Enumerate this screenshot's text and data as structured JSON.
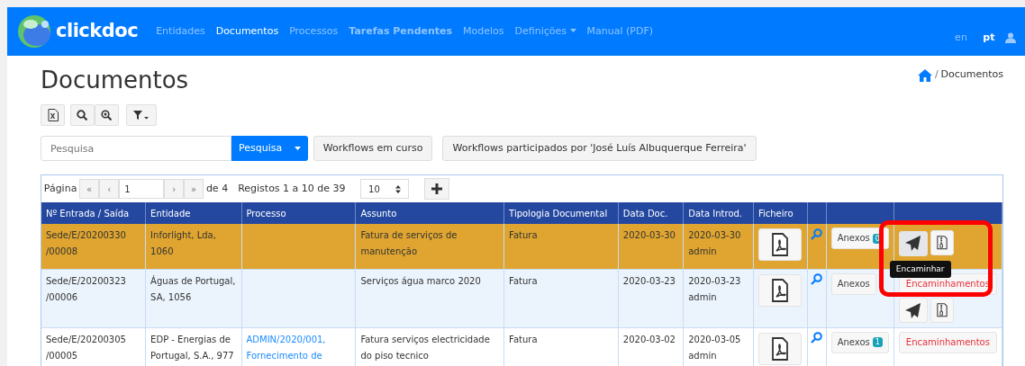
{
  "brand": {
    "name": "clickdoc"
  },
  "nav": [
    {
      "label": "Entidades",
      "selected": false,
      "bold": false,
      "dropdown": false
    },
    {
      "label": "Documentos",
      "selected": true,
      "bold": false,
      "dropdown": false
    },
    {
      "label": "Processos",
      "selected": false,
      "bold": false,
      "dropdown": false
    },
    {
      "label": "Tarefas Pendentes",
      "selected": false,
      "bold": true,
      "dropdown": false
    },
    {
      "label": "Modelos",
      "selected": false,
      "bold": false,
      "dropdown": false
    },
    {
      "label": "Definições",
      "selected": false,
      "bold": false,
      "dropdown": true
    },
    {
      "label": "Manual (PDF)",
      "selected": false,
      "bold": false,
      "dropdown": false
    }
  ],
  "languages": [
    {
      "label": "en",
      "selected": false
    },
    {
      "label": "pt",
      "selected": true
    }
  ],
  "page_title": "Documentos",
  "breadcrumb": [
    {
      "separator": "/",
      "label": "Documentos"
    }
  ],
  "search": {
    "placeholder": "Pesquisa",
    "button": "Pesquisa"
  },
  "workflow_buttons": [
    "Workflows em curso",
    "Workflows participados por 'José Luís Albuquerque Ferreira'"
  ],
  "pager": {
    "first": "«",
    "prev": "‹",
    "next": "›",
    "last": "»",
    "label": "Página",
    "page": "1",
    "of": "de 4",
    "records": "Registos 1 a 10 de 39",
    "page_size": "10"
  },
  "table": {
    "columns": [
      "Nº Entrada / Saída",
      "Entidade",
      "Processo",
      "Assunto",
      "Tipologia Documental",
      "Data Doc.",
      "Data Introd.",
      "Ficheiro"
    ],
    "rows": [
      {
        "number": "Sede/E/20200330 /00008",
        "entity": "Inforlight, Lda, 1060",
        "process": "",
        "subject": "Fatura de serviços de manutenção",
        "type": "Fatura",
        "date_doc": "2020-03-30",
        "date_intro": "2020-03-30",
        "user": "admin",
        "attachments": "Anexos",
        "attachments_count": "0",
        "forwards": "",
        "selected": true,
        "actions": true
      },
      {
        "number": "Sede/E/20200323 /00006",
        "entity": "Águas de Portugal, SA, 1056",
        "process": "",
        "subject": "Serviços água marco 2020",
        "type": "Fatura",
        "date_doc": "2020-03-23",
        "date_intro": "2020-03-23",
        "user": "admin",
        "attachments": "Anexos",
        "attachments_count": "",
        "forwards": "Encaminhamentos",
        "selected": false,
        "actions": true
      },
      {
        "number": "Sede/E/20200305 /00005",
        "entity": "EDP - Energias de Portugal, S.A., 977",
        "process": "ADMIN/2020/001, Fornecimento de",
        "subject": "Fatura serviços electricidade do piso tecnico",
        "type": "Fatura",
        "date_doc": "2020-03-02",
        "date_intro": "2020-03-05",
        "user": "admin",
        "attachments": "Anexos",
        "attachments_count": "1",
        "forwards": "Encaminhamentos",
        "selected": false,
        "actions": false
      }
    ]
  },
  "tooltip": {
    "text": "Encaminhar"
  }
}
